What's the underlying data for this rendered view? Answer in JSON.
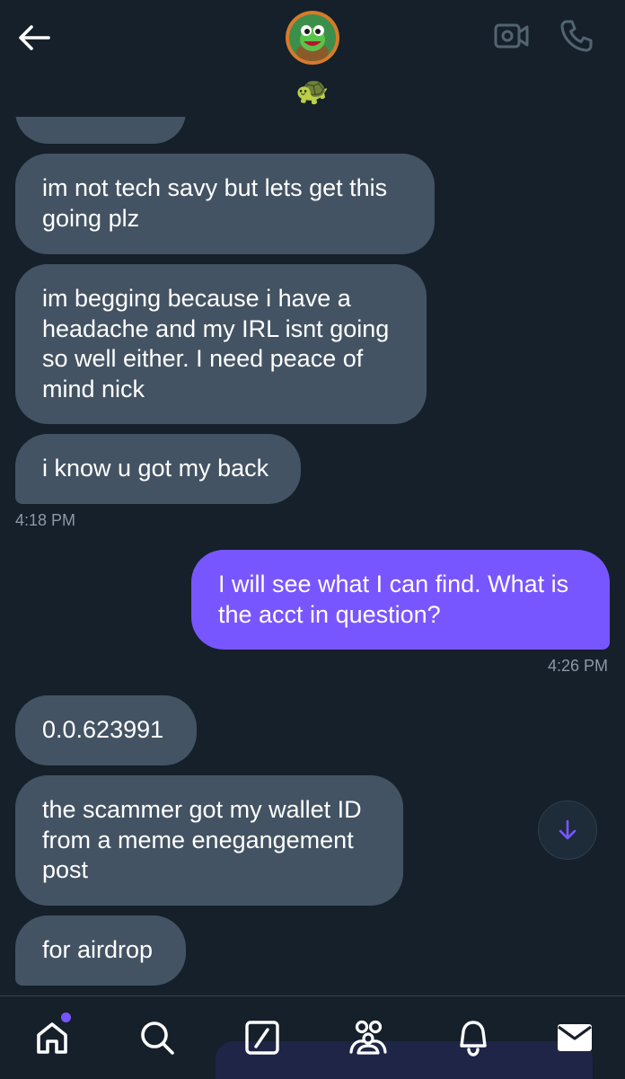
{
  "header": {
    "back_icon": "arrow-left-icon",
    "avatar_desc": "turtle-avatar",
    "emoji": "🐢",
    "video_icon": "video-camera-icon",
    "call_icon": "phone-icon"
  },
  "messages": [
    {
      "dir": "in",
      "text": "im not tech savy but lets get this going plz"
    },
    {
      "dir": "in",
      "text": "im begging because i have a headache and my IRL isnt going so well either. I need peace of mind nick"
    },
    {
      "dir": "in",
      "text": "i know u got my back"
    },
    {
      "dir": "out",
      "text": "I will see what I can find. What is the acct in question?"
    },
    {
      "dir": "in",
      "text": "0.0.623991"
    },
    {
      "dir": "in",
      "text": "the scammer got my wallet ID from a meme enegangement post"
    },
    {
      "dir": "in",
      "text": "for airdrop"
    }
  ],
  "timestamps": {
    "t1": "4:18 PM",
    "t2": "4:26 PM"
  },
  "scroll_down_icon": "arrow-down-icon",
  "nav": {
    "items": [
      "home-icon",
      "search-icon",
      "grok-icon",
      "communities-icon",
      "notifications-icon",
      "messages-icon"
    ]
  },
  "colors": {
    "background": "#15202b",
    "incoming_bubble": "#435363",
    "outgoing_bubble": "#7856ff",
    "timestamp": "#8b98a5"
  }
}
